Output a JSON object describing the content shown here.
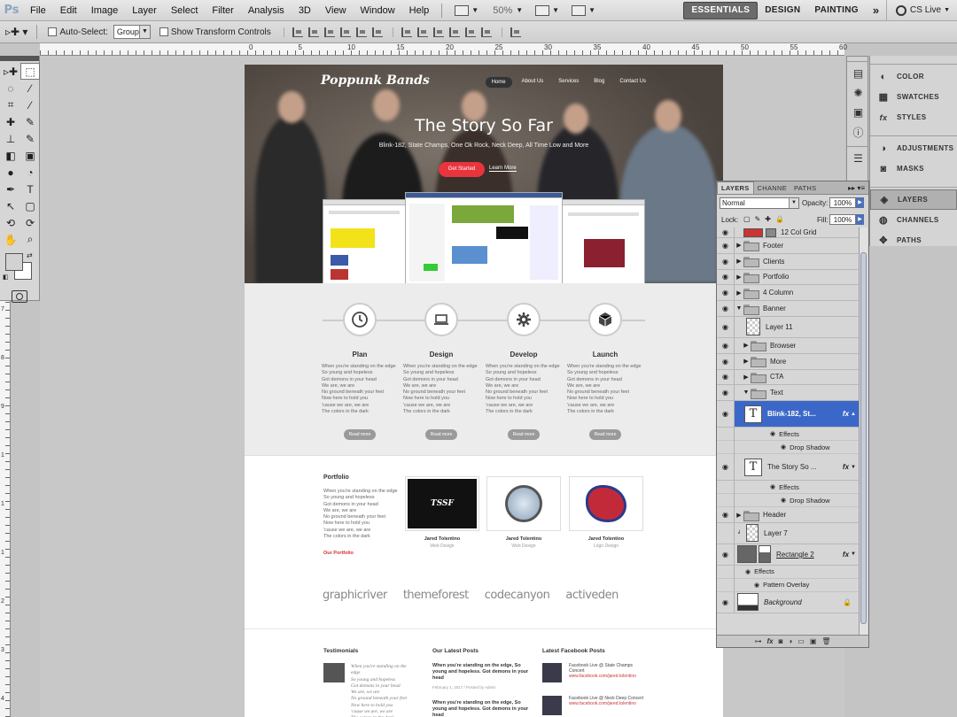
{
  "app": {
    "logo": "Ps"
  },
  "menubar": {
    "items": [
      "File",
      "Edit",
      "Image",
      "Layer",
      "Select",
      "Filter",
      "Analysis",
      "3D",
      "View",
      "Window",
      "Help"
    ],
    "zoom": "50%",
    "workspaces": [
      "ESSENTIALS",
      "DESIGN",
      "PAINTING"
    ],
    "more": "»",
    "cslive": "CS Live"
  },
  "options": {
    "auto_select_label": "Auto-Select:",
    "auto_select_value": "Group",
    "transform_label": "Show Transform Controls"
  },
  "ruler": {
    "top": [
      "0",
      "5",
      "10",
      "15",
      "20",
      "25",
      "30",
      "35",
      "40",
      "45",
      "50",
      "55",
      "60"
    ],
    "left": [
      "7",
      "8",
      "9",
      "1",
      "1",
      "1",
      "2",
      "3",
      "4"
    ]
  },
  "tools": {
    "icons": [
      "move-icon",
      "marquee-icon",
      "lasso-icon",
      "quick-select-icon",
      "crop-icon",
      "eyedropper-icon",
      "healing-icon",
      "brush-icon",
      "stamp-icon",
      "history-brush-icon",
      "eraser-icon",
      "gradient-icon",
      "blur-icon",
      "dodge-icon",
      "pen-icon",
      "type-icon",
      "path-select-icon",
      "shape-icon",
      "3d-rotate-icon",
      "3d-orbit-icon",
      "hand-icon",
      "zoom-icon"
    ],
    "glyphs": [
      "▹✚",
      "⬚",
      "◌",
      "⁄",
      "⌗",
      "⁄",
      "✚",
      "✎",
      "⊥",
      "✎",
      "◧",
      "▣",
      "●",
      "◔",
      "✒",
      "T",
      "↖",
      "▢",
      "⟲",
      "⟳",
      "✋",
      "⌕"
    ],
    "fg_color": "#d2d2d2",
    "bg_color": "#ffffff"
  },
  "document": {
    "logo": "Poppunk Bands",
    "nav": [
      "Home",
      "About Us",
      "Services",
      "Blog",
      "Contact Us"
    ],
    "hero_title": "The Story So Far",
    "hero_sub": "Blink-182, State Champs, One Ok Rock, Neck Deep, All Time Low and More",
    "cta": "Get Started",
    "learn": "Learn More",
    "steps": [
      {
        "title": "Plan",
        "button": "Read more"
      },
      {
        "title": "Design",
        "button": "Read more"
      },
      {
        "title": "Develop",
        "button": "Read more"
      },
      {
        "title": "Launch",
        "button": "Read more"
      }
    ],
    "step_text": "When you're standing on the edge\nSo young and hopeless\nGot demons in your head\nWe are, we are\nNo ground beneath your feet\nNow here to hold you\n'cause we are, we are\nThe colors in the dark",
    "portfolio_title": "Portfolio",
    "portfolio_text": "When you're standing on the edge\nSo young and hopeless\nGot demons in your head\nWe are, we are\nNo ground beneath your feet\nNow here to hold you\n'cause we are, we are\nThe colors in the dark",
    "portfolio_link": "Our Portfolio",
    "portfolio_items": [
      {
        "name": "Jared Tolentino",
        "role": "Web Design"
      },
      {
        "name": "Jared Tolentino",
        "role": "Web Design"
      },
      {
        "name": "Jared Tolentino",
        "role": "Logo Design"
      }
    ],
    "brands": [
      "graphicriver",
      "themeforest",
      "codecanyon",
      "activeden"
    ],
    "testimonials_title": "Testimonials",
    "testimonial_text": "When you're standing on the\nedge\nSo young and hopeless\nGot demons in your head\nWe are, we are\nNo ground beneath your feet\nNow here to hold you\n'cause we are, we are\nThe colors in the dark",
    "posts_title": "Our Latest Posts",
    "posts": [
      {
        "text": "When you're standing on the edge, So young and hopeless. Got demons in your head",
        "meta": "February 1, 2017 / Posted by Admin"
      },
      {
        "text": "When you're standing on the edge, So young and hopeless. Got demons in your head",
        "meta": ""
      }
    ],
    "fb_title": "Latest Facebook Posts",
    "fb_posts": [
      {
        "text": "Facebook Live @ State Champs Concert",
        "link": "www.facebook.com/jared.tolentino"
      },
      {
        "text": "Facebook Live @ Neck Deep Concert",
        "link": "www.facebook.com/jared.tolentino"
      }
    ]
  },
  "dock": {
    "items": [
      {
        "label": "COLOR",
        "icon": "color-icon",
        "glyph": "◐"
      },
      {
        "label": "SWATCHES",
        "icon": "swatches-icon",
        "glyph": "▦"
      },
      {
        "label": "STYLES",
        "icon": "styles-icon",
        "glyph": "fx"
      },
      {
        "label": "ADJUSTMENTS",
        "icon": "adjustments-icon",
        "glyph": "◑"
      },
      {
        "label": "MASKS",
        "icon": "masks-icon",
        "glyph": "◙"
      },
      {
        "label": "LAYERS",
        "icon": "layers-icon",
        "glyph": "◈"
      },
      {
        "label": "CHANNELS",
        "icon": "channels-icon",
        "glyph": "◍"
      },
      {
        "label": "PATHS",
        "icon": "paths-icon",
        "glyph": "✥"
      }
    ]
  },
  "layers_panel": {
    "tabs": [
      "LAYERS",
      "CHANNE",
      "PATHS"
    ],
    "blend_mode": "Normal",
    "opacity_label": "Opacity:",
    "opacity": "100%",
    "lock_label": "Lock:",
    "fill_label": "Fill:",
    "fill": "100%",
    "layers": [
      {
        "name": "12 Col Grid",
        "kind": "thumb"
      },
      {
        "name": "Footer",
        "kind": "group"
      },
      {
        "name": "Clients",
        "kind": "group"
      },
      {
        "name": "Portfolio",
        "kind": "group"
      },
      {
        "name": "4 Column",
        "kind": "group"
      },
      {
        "name": "Banner",
        "kind": "group-open"
      },
      {
        "name": "Layer 11",
        "kind": "pixel"
      },
      {
        "name": "Browser",
        "kind": "group"
      },
      {
        "name": "More",
        "kind": "group"
      },
      {
        "name": "CTA",
        "kind": "group"
      },
      {
        "name": "Text",
        "kind": "group-open"
      },
      {
        "name": "Blink-182, St...",
        "kind": "text-selected"
      },
      {
        "name": "The Story So ...",
        "kind": "text"
      },
      {
        "name": "Header",
        "kind": "group"
      },
      {
        "name": "Layer 7",
        "kind": "pixel"
      },
      {
        "name": "Rectangle 2",
        "kind": "shape"
      },
      {
        "name": "Background",
        "kind": "background"
      }
    ],
    "effects_label": "Effects",
    "drop_shadow": "Drop Shadow",
    "pattern_overlay": "Pattern Overlay"
  }
}
